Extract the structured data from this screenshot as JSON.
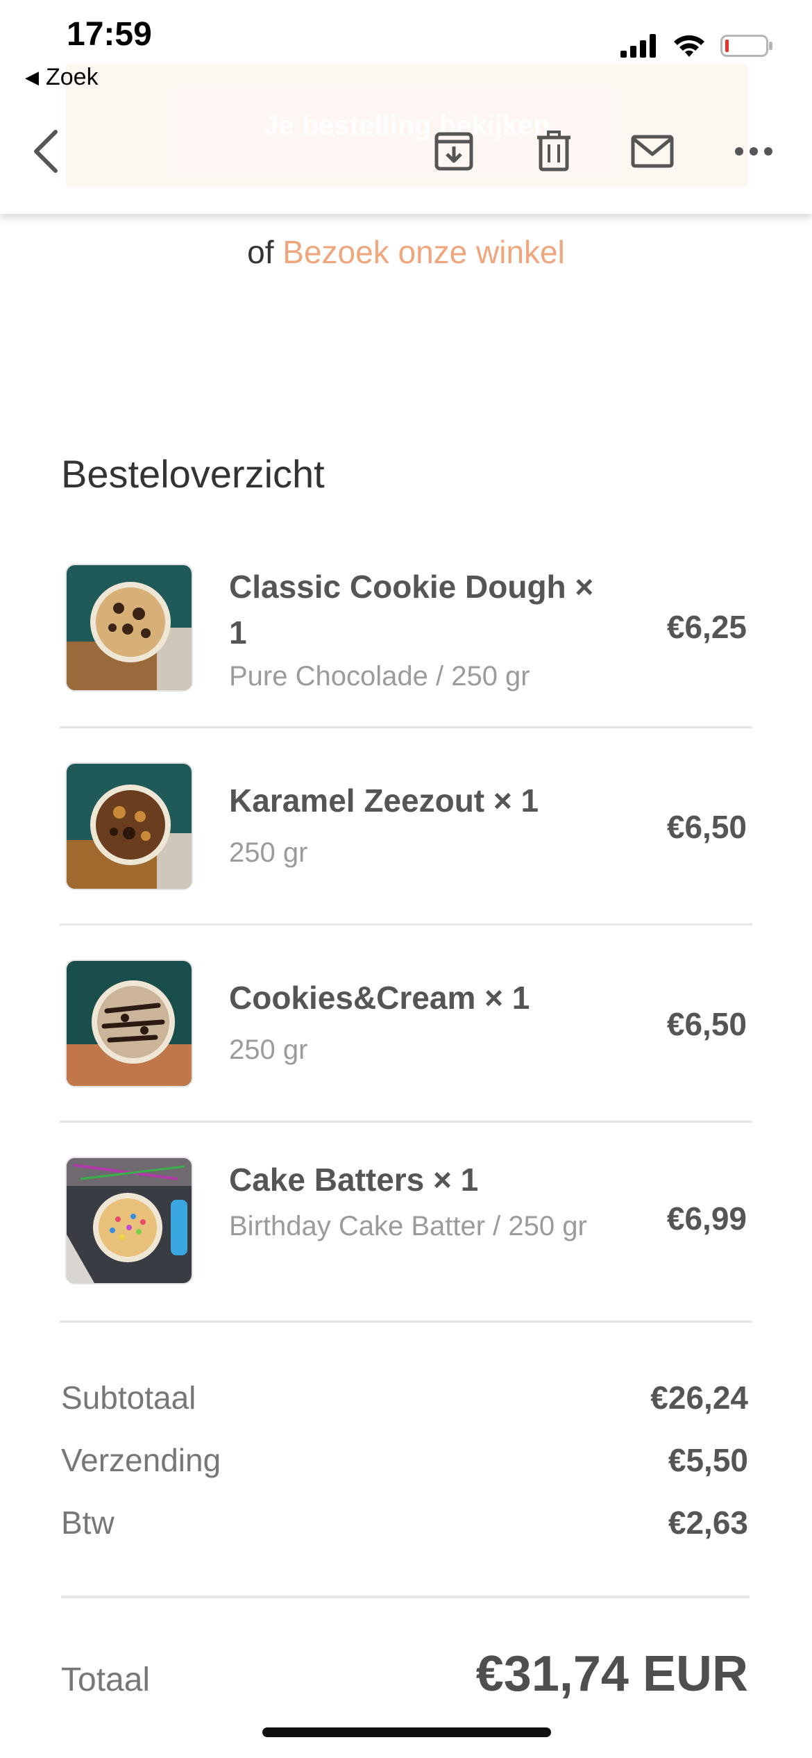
{
  "status_bar": {
    "time": "17:59",
    "back_app_label": "Zoek"
  },
  "toolbar": {
    "ghost_button_label": "Je bestelling bekijken",
    "icons": [
      "chevron-left-icon",
      "archive-icon",
      "trash-icon",
      "mail-icon",
      "more-icon"
    ]
  },
  "store": {
    "prefix": "of",
    "link_text": "Bezoek onze winkel",
    "link_color": "#f0a67c"
  },
  "summary": {
    "title": "Besteloverzicht",
    "items": [
      {
        "name": "Classic Cookie Dough × 1",
        "variant": "Pure Chocolade / 250 gr",
        "price": "€6,25"
      },
      {
        "name": "Karamel Zeezout × 1",
        "variant": "250 gr",
        "price": "€6,50"
      },
      {
        "name": "Cookies&Cream × 1",
        "variant": "250 gr",
        "price": "€6,50"
      },
      {
        "name": "Cake Batters × 1",
        "variant": "Birthday Cake Batter / 250 gr",
        "price": "€6,99"
      }
    ],
    "subtotal_label": "Subtotaal",
    "subtotal_value": "€26,24",
    "shipping_label": "Verzending",
    "shipping_value": "€5,50",
    "tax_label": "Btw",
    "tax_value": "€2,63",
    "total_label": "Totaal",
    "total_value": "€31,74 EUR"
  }
}
